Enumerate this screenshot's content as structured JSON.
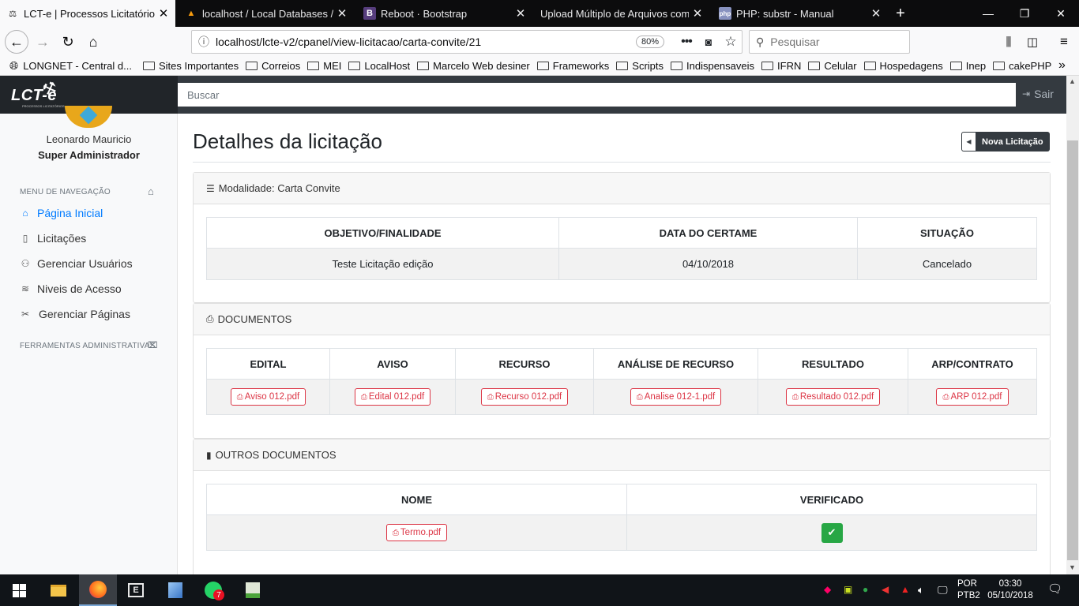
{
  "browser": {
    "tabs": [
      {
        "title": "LCT-e | Processos Licitatórios -",
        "active": true,
        "icon": "gavel-icon"
      },
      {
        "title": "localhost / Local Databases / lc",
        "active": false,
        "icon": "phpmyadmin-icon"
      },
      {
        "title": "Reboot · Bootstrap",
        "active": false,
        "icon": "bootstrap-icon"
      },
      {
        "title": "Upload Múltiplo de Arquivos com F",
        "active": false,
        "icon": "none"
      },
      {
        "title": "PHP: substr - Manual",
        "active": false,
        "icon": "php-icon"
      }
    ],
    "url": "localhost/lcte-v2/cpanel/view-licitacao/carta-convite/21",
    "zoom": "80%",
    "search_placeholder": "Pesquisar",
    "bookmarks": [
      "LONGNET - Central d...",
      "Sites Importantes",
      "Correios",
      "MEI",
      "LocalHost",
      "Marcelo Web desiner",
      "Frameworks",
      "Scripts",
      "Indispensaveis",
      "IFRN",
      "Celular",
      "Hospedagens",
      "Inep",
      "cakePHP"
    ]
  },
  "app": {
    "logo": "LCT-e",
    "logo_sub": "PROCESSOS LICITATÓRIOS",
    "search_placeholder": "Buscar",
    "logout_label": "Sair"
  },
  "sidebar": {
    "user_name": "Leonardo Mauricio",
    "user_role": "Super Administrador",
    "nav_heading": "MENU DE NAVEGAÇÃO",
    "items": [
      {
        "label": "Página Inicial",
        "icon": "home-icon",
        "active": true
      },
      {
        "label": "Licitações",
        "icon": "file-icon",
        "active": false
      },
      {
        "label": "Gerenciar Usuários",
        "icon": "users-icon",
        "active": false
      },
      {
        "label": "Niveis de Acesso",
        "icon": "layers-icon",
        "active": false
      },
      {
        "label": "Gerenciar Páginas",
        "icon": "pages-icon",
        "active": false
      }
    ],
    "tools_heading": "FERRAMENTAS ADMINISTRATIVAS"
  },
  "main": {
    "page_title": "Detalhes da licitação",
    "new_button": "Nova Licitação",
    "modalidade": {
      "header": "Modalidade: Carta Convite",
      "columns": [
        "OBJETIVO/FINALIDADE",
        "DATA DO CERTAME",
        "SITUAÇÃO"
      ],
      "row": [
        "Teste Licitação edição",
        "04/10/2018",
        "Cancelado"
      ]
    },
    "documentos": {
      "header": "DOCUMENTOS",
      "columns": [
        "EDITAL",
        "AVISO",
        "RECURSO",
        "ANÁLISE DE RECURSO",
        "RESULTADO",
        "ARP/CONTRATO"
      ],
      "files": [
        "Aviso 012.pdf",
        "Edital 012.pdf",
        "Recurso 012.pdf",
        "Analise 012-1.pdf",
        "Resultado 012.pdf",
        "ARP 012.pdf"
      ]
    },
    "outros": {
      "header": "OUTROS DOCUMENTOS",
      "columns": [
        "NOME",
        "VERIFICADO"
      ],
      "file": "Termo.pdf",
      "verified": true
    }
  },
  "taskbar": {
    "lang_top": "POR",
    "lang_bottom": "PTB2",
    "time": "03:30",
    "date": "05/10/2018",
    "whatsapp_badge": "7"
  },
  "colors": {
    "accent": "#007bff",
    "danger": "#dc3545",
    "success": "#28a745",
    "dark": "#343a40"
  }
}
